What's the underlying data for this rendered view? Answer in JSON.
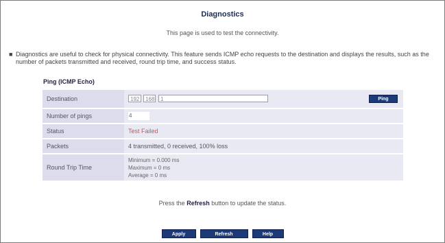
{
  "page": {
    "title": "Diagnostics",
    "subtitle": "This page is used to test the connectivity.",
    "intro": "Diagnostics are useful to check for physical connectivity. This feature sends ICMP echo requests to the destination and displays the results, such as the number of packets transmitted and received, round trip time, and success status."
  },
  "ping": {
    "section_title": "Ping (ICMP Echo)",
    "destination_label": "Destination",
    "destination_octet1": "192",
    "destination_octet2": "168",
    "destination_rest": "1",
    "start_button": "Ping",
    "number_label": "Number of pings",
    "number_value": "4",
    "status_label": "Status",
    "status_value": "Test Failed",
    "packets_label": "Packets",
    "packets_value": "4 transmitted, 0 received, 100% loss",
    "rtt_label": "Round Trip Time",
    "rtt_min": "Minimum = 0.000 ms",
    "rtt_max": "Maximum = 0 ms",
    "rtt_avg": "Average = 0 ms"
  },
  "footer": {
    "note_prefix": "Press the ",
    "note_bold": "Refresh",
    "note_suffix": " button to update the status.",
    "apply_button": "Apply",
    "refresh_button": "Refresh",
    "help_button": "Help"
  },
  "colors": {
    "button_bg": "#1d3a78",
    "label_cell": "#dcdcec",
    "value_cell": "#e9e9f4",
    "status_error": "#cc5555",
    "frame_border": "#7a7a7a"
  }
}
